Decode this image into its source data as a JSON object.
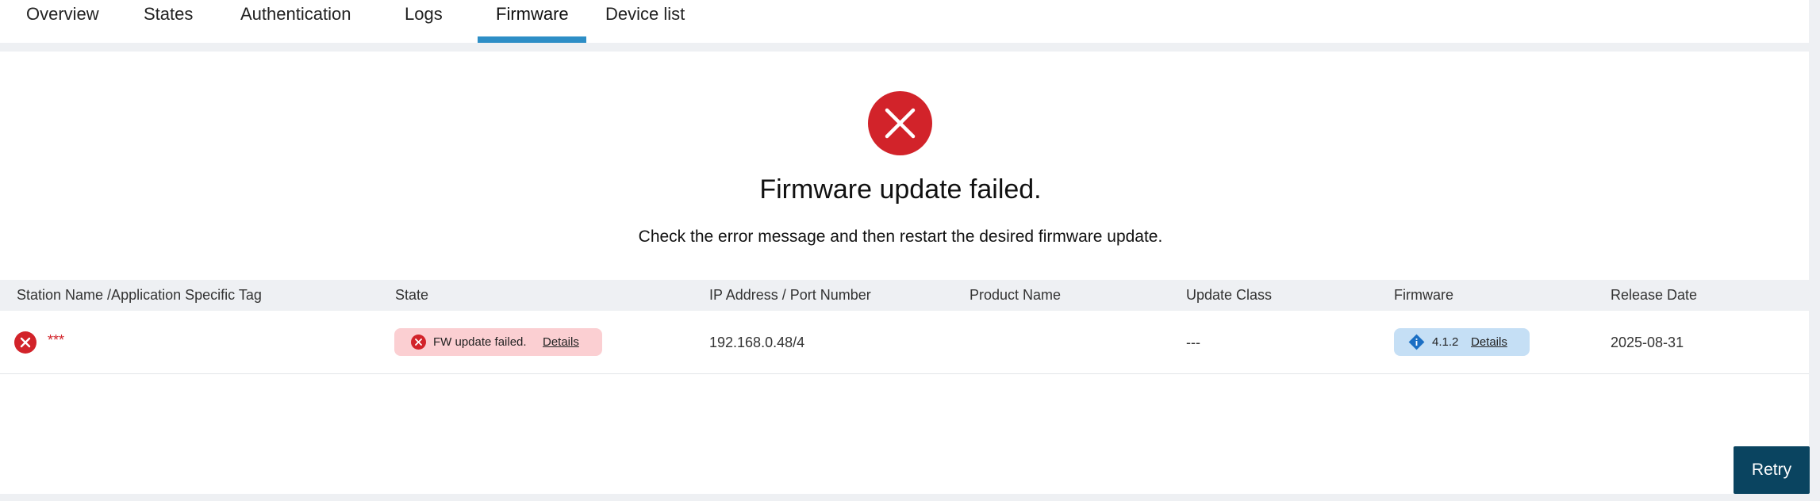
{
  "tabs": [
    {
      "label": "Overview"
    },
    {
      "label": "States"
    },
    {
      "label": "Authentication"
    },
    {
      "label": "Logs"
    },
    {
      "label": "Firmware",
      "active": true
    },
    {
      "label": "Device list"
    }
  ],
  "status": {
    "icon": "error-x-icon",
    "title": "Firmware update failed.",
    "message": "Check the error message and then restart the desired firmware update."
  },
  "table": {
    "columns": [
      "Station Name /Application Specific Tag",
      "State",
      "IP Address / Port Number",
      "Product Name",
      "Update Class",
      "Firmware",
      "Release Date"
    ],
    "rows": [
      {
        "station_name": "***",
        "state": {
          "text": "FW update failed.",
          "link": "Details"
        },
        "ip_port": "192.168.0.48/4",
        "product_name": "",
        "update_class": "---",
        "firmware": {
          "version": "4.1.2",
          "link": "Details"
        },
        "release_date": "2025-08-31"
      }
    ]
  },
  "footer": {
    "retry_label": "Retry"
  },
  "colors": {
    "accent": "#2d8ec6",
    "error": "#d2232a",
    "error_bg": "#fbcfd2",
    "info": "#1b6fc4",
    "info_bg": "#c5dff5",
    "primary_button": "#0a4460"
  }
}
